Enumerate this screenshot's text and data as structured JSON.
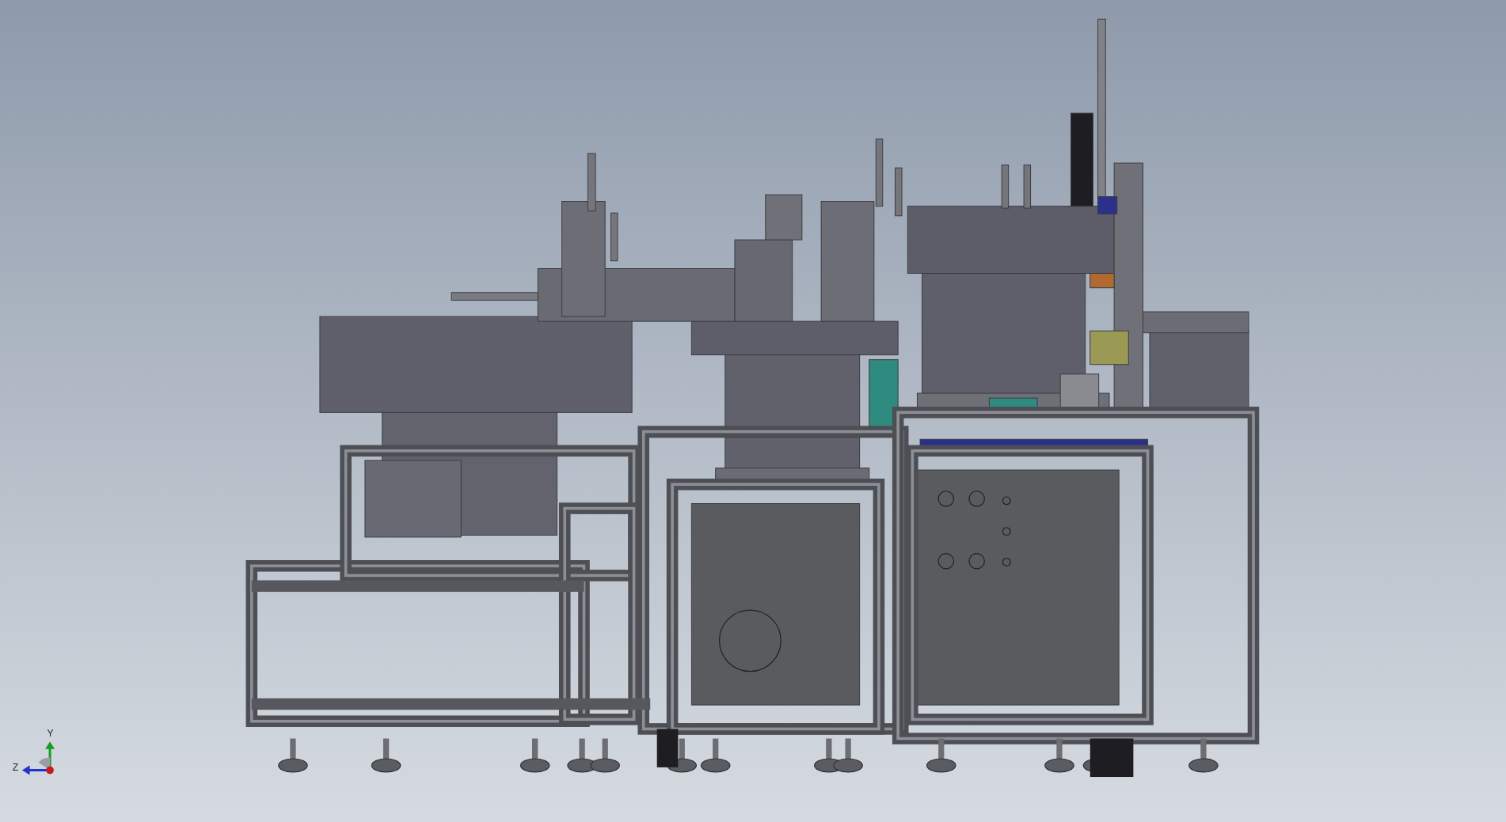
{
  "viewport": {
    "triad": {
      "labels": [
        "Y",
        "Z"
      ]
    }
  }
}
